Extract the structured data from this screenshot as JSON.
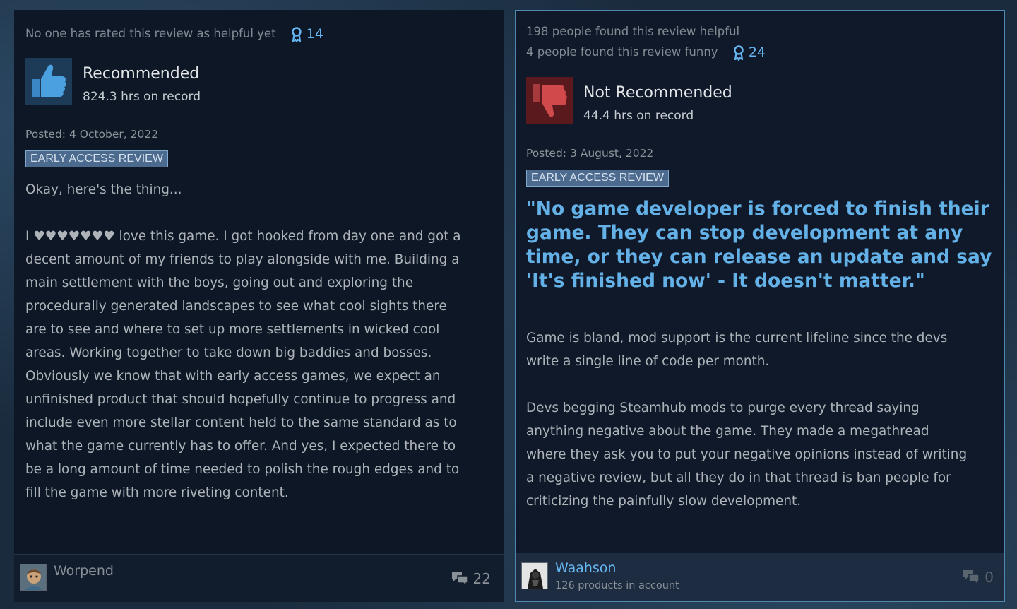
{
  "reviews": [
    {
      "helpful_text": "No one has rated this review as helpful yet",
      "funny_text": "",
      "award_count": "14",
      "verdict": "Recommended",
      "hours": "824.3 hrs on record",
      "posted": "Posted: 4 October, 2022",
      "badge": "EARLY ACCESS REVIEW",
      "body": [
        "Okay, here's the thing...",
        "",
        "I ♥♥♥♥♥♥♥ love this game. I got hooked from day one and got a",
        "decent amount of my friends to play alongside with me. Building a",
        "main settlement with the boys, going out and exploring the",
        "procedurally generated landscapes to see what cool sights there",
        "are to see and where to set up more settlements in wicked cool",
        "areas. Working together to take down big baddies and bosses.",
        "Obviously we know that with early access games, we expect an",
        "unfinished product that should hopefully continue to progress and",
        "include even more stellar content held to the same standard as to",
        "what the game currently has to offer. And yes, I expected there to",
        "be a long amount of time needed to polish the rough edges and to",
        "fill the game with more riveting content."
      ],
      "author": "Worpend",
      "comment_count": "22",
      "thumb_color": "#3b86c4",
      "thumb_bg": "#1d3a57"
    },
    {
      "helpful_text": "198 people found this review helpful",
      "funny_text": "4 people found this review funny",
      "award_count": "24",
      "verdict": "Not Recommended",
      "hours": "44.4 hrs on record",
      "posted": "Posted: 3 August, 2022",
      "badge": "EARLY ACCESS REVIEW",
      "quote": [
        "\"No game developer is forced to finish their",
        "game. They can stop development at any",
        "time, or they can release an update and say",
        "'It's finished now' - It doesn't matter.\""
      ],
      "body": [
        "Game is bland, mod support is the current lifeline since the devs",
        "write a single line of code per month.",
        "",
        "Devs begging Steamhub mods to purge every thread saying",
        "anything negative about the game. They made a megathread",
        "where they ask you to put your negative opinions instead of writing",
        "a negative review, but all they do in that thread is ban people for",
        "criticizing the painfully slow development."
      ],
      "author": "Waahson",
      "products": "126 products in account",
      "comment_count": "0",
      "thumb_color": "#c24a4a",
      "thumb_bg": "#5a1a1d"
    }
  ],
  "colors": {
    "award": "#66b7f2",
    "link": "#66b7f2",
    "quote": "#63b1e6"
  },
  "icons": [
    "award-ribbon-icon",
    "thumbs-up-icon",
    "thumbs-down-icon",
    "comment-bubbles-icon"
  ]
}
